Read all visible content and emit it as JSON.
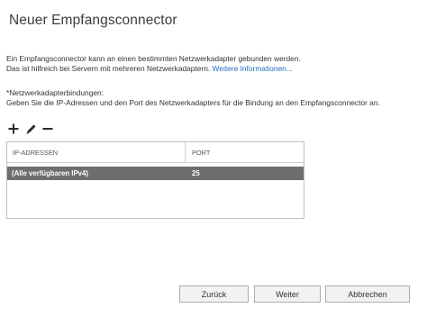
{
  "wizard": {
    "title": "Neuer Empfangsconnector"
  },
  "intro": {
    "line1": "Ein Empfangsconnector kann an einen bestimmten Netzwerkadapter gebunden werden.",
    "line2": "Das ist hilfreich bei Servern mit mehreren Netzwerkadaptern.",
    "link": "Weitere Informationen..."
  },
  "binding": {
    "label": "*Netzwerkadapterbindungen:",
    "description": "Geben Sie die IP-Adressen und den Port des Netzwerkadapters für die Bindung an den Empfangsconnector an."
  },
  "toolbar": {
    "icons": [
      "add-icon",
      "edit-icon",
      "remove-icon"
    ]
  },
  "table": {
    "columns": [
      "IP-ADRESSEN",
      "PORT"
    ],
    "rows": [
      {
        "ip": "(Alle verfügbaren IPv4)",
        "port": "25",
        "selected": true
      }
    ]
  },
  "buttons": {
    "back": "Zurück",
    "next": "Weiter",
    "cancel": "Abbrechen"
  },
  "colors": {
    "selected_row": "#6e6e6e",
    "link": "#1f6fbf"
  }
}
